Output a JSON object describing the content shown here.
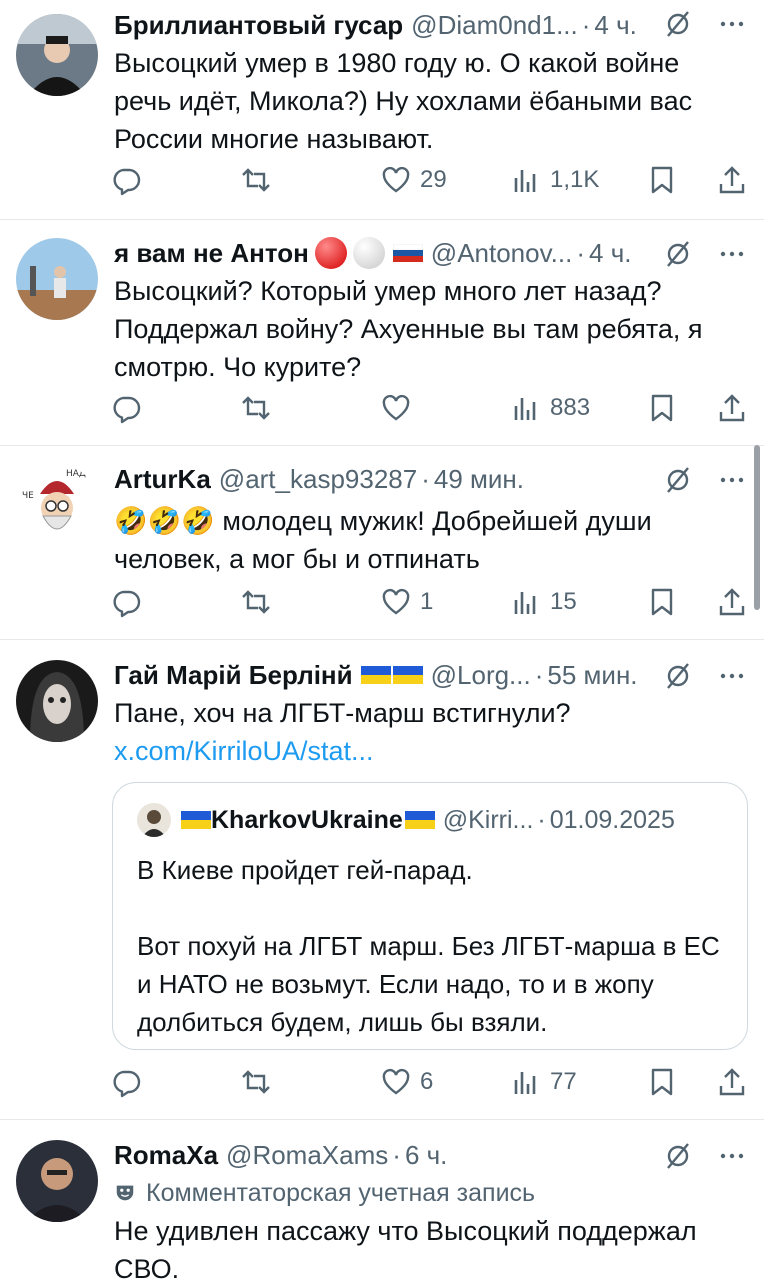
{
  "tweets": [
    {
      "name": "Бриллиантовый гусар",
      "handle": "@Diam0nd1...",
      "sep": "·",
      "time": "4 ч.",
      "text": "Высоцкий умер в 1980 году ю. О какой войне речь идёт, Микола?) Ну хохлами ёбаными вас России многие называют.",
      "retweets": "",
      "likes": "29",
      "views": "1,1K"
    },
    {
      "name": "я вам не Антон",
      "handle": "@Antonov...",
      "sep": "·",
      "time": "4 ч.",
      "text": "Высоцкий? Который умер много лет назад? Поддержал войну? Ахуенные вы там ребята, я смотрю. Чо курите?",
      "retweets": "",
      "likes": "",
      "views": "883"
    },
    {
      "name": "ArturKa",
      "handle": "@art_kasp93287",
      "sep": "·",
      "time": "49 мин.",
      "emoji": "🤣🤣🤣",
      "text": "молодец мужик! Добрейшей души человек, а мог бы и отпинать",
      "retweets": "",
      "likes": "1",
      "views": "15"
    },
    {
      "name": "Гай Марій Берлінй",
      "handle": "@Lorg...",
      "sep": "·",
      "time": "55 мин.",
      "text": "Пане, хоч на ЛГБТ-марш встигнули?",
      "link": "x.com/KirriloUA/stat...",
      "quote": {
        "name": "KharkovUkraine",
        "handle": "@Kirri...",
        "sep": "·",
        "date": "01.09.2025",
        "text": "В Киеве пройдет гей-парад.\n\nВот похуй на ЛГБТ марш. Без ЛГБТ-марша в ЕС и НАТО не возьмут. Если надо, то и в жопу долбиться будем, лишь бы взяли."
      },
      "retweets": "",
      "likes": "6",
      "views": "77"
    },
    {
      "name": "RomaXa",
      "handle": "@RomaXams",
      "sep": "·",
      "time": "6 ч.",
      "label": "Комментаторская учетная запись",
      "text": "Не удивлен пассажу что Высоцкий поддержал СВО."
    }
  ],
  "colors": {
    "text": "#0f1419",
    "secondary": "#536471",
    "link": "#1d9bf0",
    "divider": "#e6e9eb"
  },
  "icons": [
    "reply-icon",
    "retweet-icon",
    "like-icon",
    "views-icon",
    "bookmark-icon",
    "share-icon",
    "grok-icon",
    "more-icon"
  ]
}
